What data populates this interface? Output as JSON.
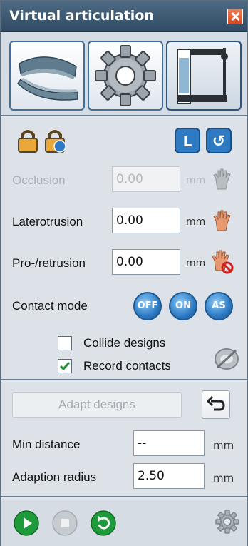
{
  "window": {
    "title": "Virtual articulation"
  },
  "toolbar": {
    "buttons": [
      {
        "name": "jaw-models-icon"
      },
      {
        "name": "settings-gear-icon"
      },
      {
        "name": "articulator-icon"
      }
    ]
  },
  "lock_row": {
    "left": [
      "lock-icon",
      "lock-reset-icon"
    ],
    "right": [
      {
        "name": "left-icon",
        "glyph": "L"
      },
      {
        "name": "reset-icon",
        "glyph": "↺"
      }
    ]
  },
  "fields": {
    "occlusion": {
      "label": "Occlusion",
      "value": "0.00",
      "unit": "mm",
      "enabled": false
    },
    "laterotrusion": {
      "label": "Laterotrusion",
      "value": "0.00",
      "unit": "mm",
      "enabled": true
    },
    "protrusion": {
      "label": "Pro-/retrusion",
      "value": "0.00",
      "unit": "mm",
      "enabled": true
    }
  },
  "contact_mode": {
    "label": "Contact mode",
    "buttons": [
      {
        "label": "OFF"
      },
      {
        "label": "ON"
      },
      {
        "label": "AS"
      }
    ]
  },
  "checkboxes": {
    "collide_designs": {
      "label": "Collide designs",
      "checked": false
    },
    "record_contacts": {
      "label": "Record contacts",
      "checked": true
    }
  },
  "adapt": {
    "button_label": "Adapt designs",
    "min_distance": {
      "label": "Min distance",
      "value": "--",
      "unit": "mm"
    },
    "adaption_radius": {
      "label": "Adaption radius",
      "value": "2.50",
      "unit": "mm"
    }
  },
  "colors": {
    "accent": "#2e7bc4",
    "titlebar": "#3c5872",
    "close": "#e05a30",
    "go": "#1f9a3a"
  }
}
